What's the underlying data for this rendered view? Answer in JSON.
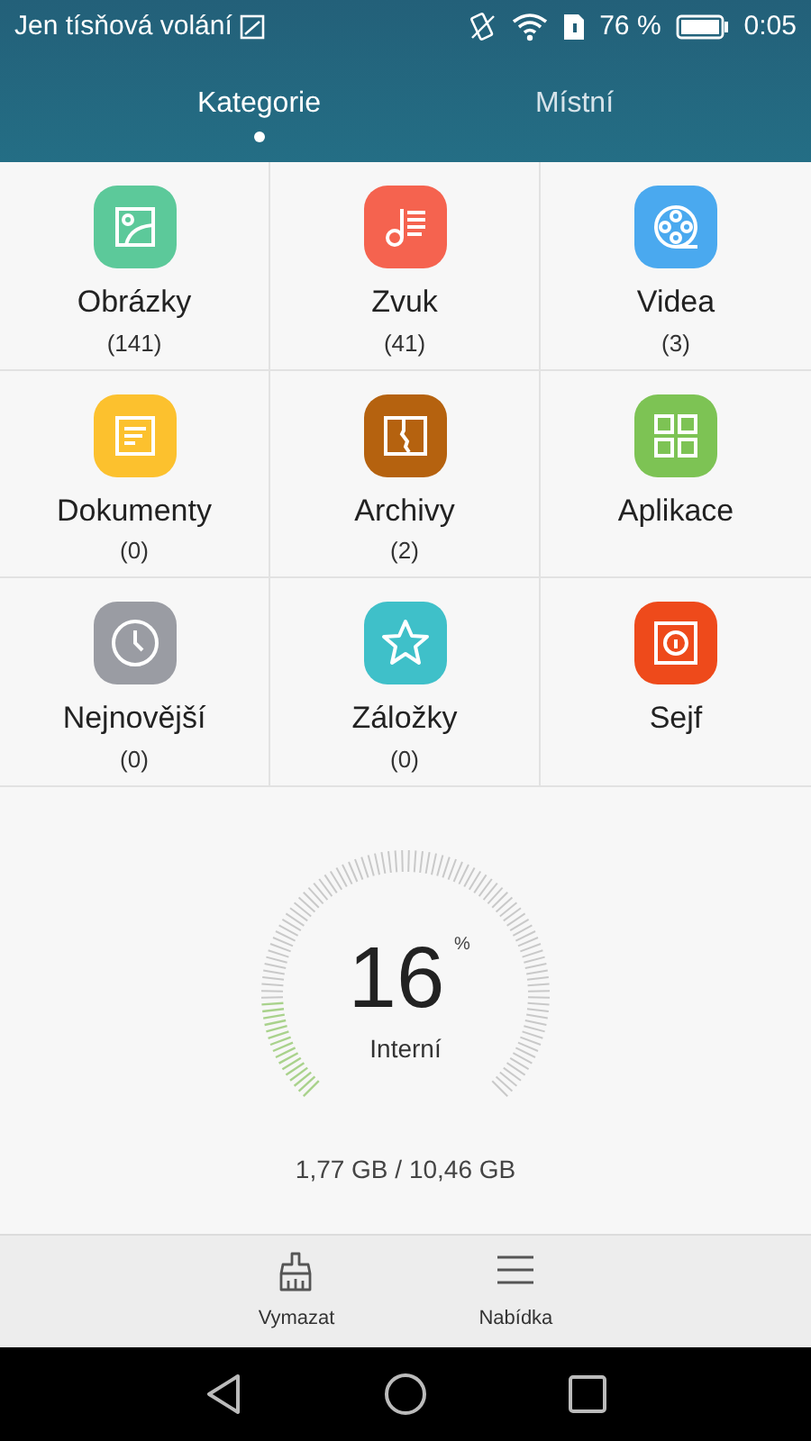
{
  "status_bar": {
    "notice": "Jen tísňová volání",
    "battery": "76 %",
    "time": "0:05"
  },
  "tabs": [
    {
      "label": "Kategorie",
      "selected": true
    },
    {
      "label": "Místní",
      "selected": false
    }
  ],
  "categories": [
    {
      "kind": "images",
      "label": "Obrázky",
      "count": "(141)",
      "color": "#5cc99a"
    },
    {
      "kind": "audio",
      "label": "Zvuk",
      "count": "(41)",
      "color": "#f5634f"
    },
    {
      "kind": "video",
      "label": "Videa",
      "count": "(3)",
      "color": "#4aa9ef"
    },
    {
      "kind": "documents",
      "label": "Dokumenty",
      "count": "(0)",
      "color": "#fcc12e"
    },
    {
      "kind": "archives",
      "label": "Archivy",
      "count": "(2)",
      "color": "#b5620f"
    },
    {
      "kind": "apps",
      "label": "Aplikace",
      "color": "#7dc354"
    },
    {
      "kind": "recent",
      "label": "Nejnovější",
      "count": "(0)",
      "color": "#9a9ca3"
    },
    {
      "kind": "bookmarks",
      "label": "Záložky",
      "count": "(0)",
      "color": "#3fc0c9"
    },
    {
      "kind": "safe",
      "label": "Sejf",
      "color": "#ee4a1b"
    }
  ],
  "storage": {
    "percent": "16",
    "unit": "%",
    "name": "Interní",
    "usage": "1,77 GB / 10,46 GB"
  },
  "actions": [
    {
      "kind": "clean",
      "label": "Vymazat"
    },
    {
      "kind": "menu",
      "label": "Nabídka"
    }
  ]
}
